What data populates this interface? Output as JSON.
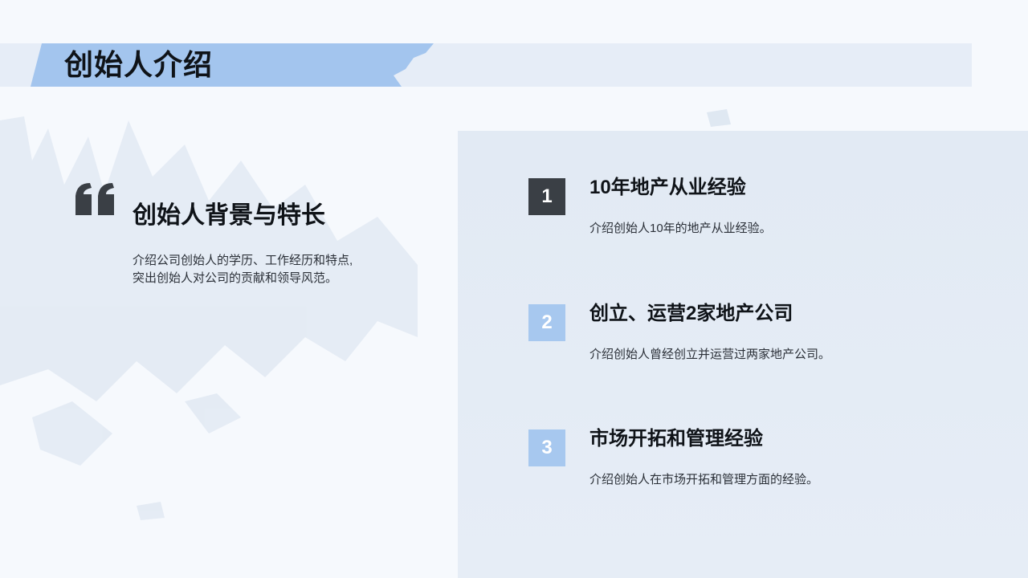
{
  "header": {
    "title": "创始人介绍"
  },
  "intro": {
    "heading": "创始人背景与特长",
    "description_line1": "介绍公司创始人的学历、工作经历和特点,",
    "description_line2": "突出创始人对公司的贡献和领导风范。"
  },
  "items": [
    {
      "number": "1",
      "title": "10年地产从业经验",
      "description": "介绍创始人10年的地产从业经验。"
    },
    {
      "number": "2",
      "title": "创立、运营2家地产公司",
      "description": "介绍创始人曾经创立并运营过两家地产公司。"
    },
    {
      "number": "3",
      "title": "市场开拓和管理经验",
      "description": "介绍创始人在市场开拓和管理方面的经验。"
    }
  ],
  "colors": {
    "accent_blue": "#a7c8ef",
    "dark_badge": "#3a3f45",
    "panel": "#e2eaf4"
  }
}
